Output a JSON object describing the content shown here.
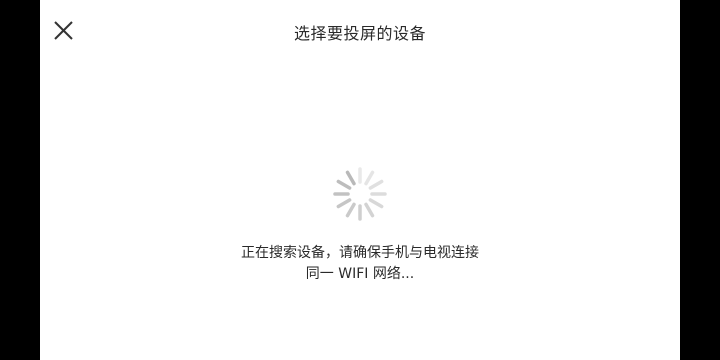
{
  "header": {
    "title": "选择要投屏的设备",
    "close_icon": "close-icon"
  },
  "loading": {
    "icon": "spinner-icon",
    "status_line1": "正在搜索设备，请确保手机与电视连接",
    "status_line2": "同一 WIFI 网络..."
  },
  "colors": {
    "background": "#ffffff",
    "letterbox": "#000000",
    "text": "#2a2a2a",
    "spinner": "#b9b9b9"
  }
}
